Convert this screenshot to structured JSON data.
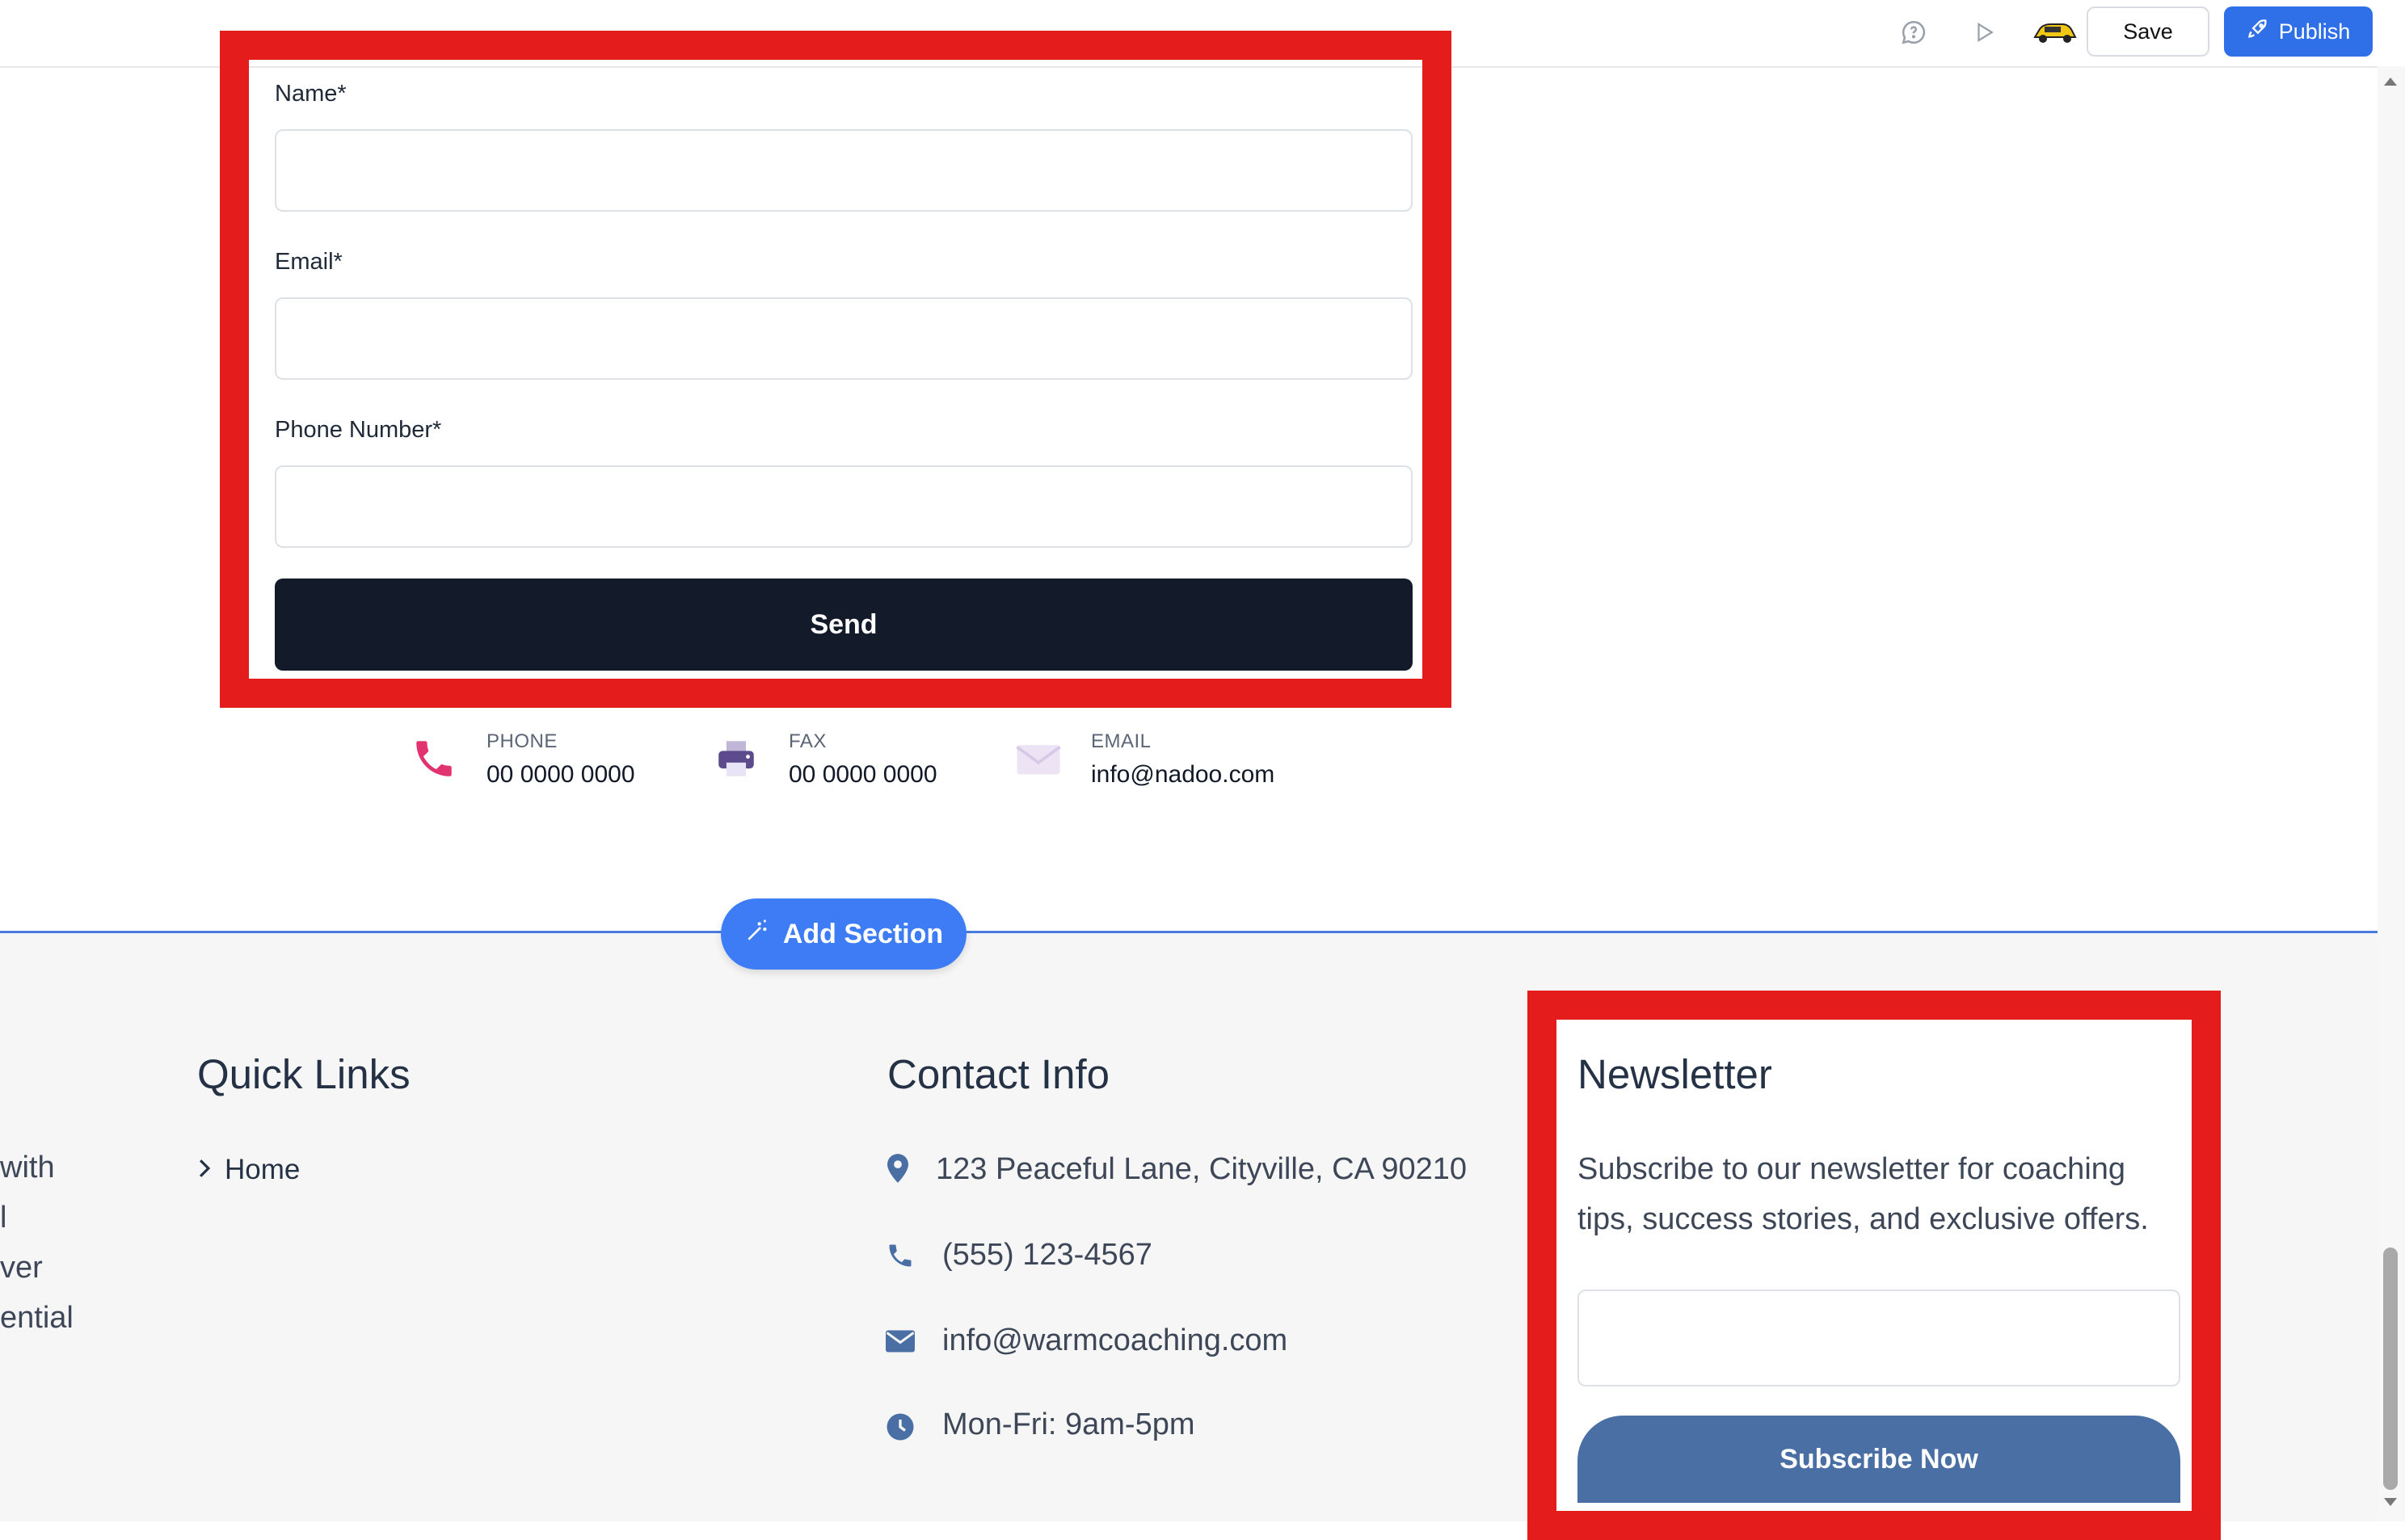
{
  "toolbar": {
    "save_label": "Save",
    "publish_label": "Publish",
    "icons": [
      "comment-icon",
      "play-icon",
      "car-avatar-icon",
      "rocket-icon"
    ]
  },
  "form": {
    "name_label": "Name*",
    "email_label": "Email*",
    "phone_label": "Phone Number*",
    "name_value": "",
    "email_value": "",
    "phone_value": "",
    "send_label": "Send"
  },
  "contact_strip": [
    {
      "label": "PHONE",
      "value": "00 0000 0000",
      "icon": "phone-icon"
    },
    {
      "label": "FAX",
      "value": "00 0000 0000",
      "icon": "fax-icon"
    },
    {
      "label": "EMAIL",
      "value": "info@nadoo.com",
      "icon": "envelope-icon"
    }
  ],
  "add_section_label": "Add Section",
  "footer": {
    "left_fragments": [
      "with",
      "l",
      "ver",
      "ential"
    ],
    "quick_links": {
      "heading": "Quick Links",
      "items": [
        "Home"
      ]
    },
    "contact_info": {
      "heading": "Contact Info",
      "address": "123 Peaceful Lane, Cityville, CA 90210",
      "phone": "(555) 123-4567",
      "email": "info@warmcoaching.com",
      "hours": "Mon-Fri: 9am-5pm"
    },
    "newsletter": {
      "heading": "Newsletter",
      "text_line1": "Subscribe to our newsletter for coaching",
      "text_line2": "tips, success stories, and exclusive offers.",
      "input_value": "",
      "button_label": "Subscribe Now"
    }
  },
  "colors": {
    "highlight": "#e41c1c",
    "publish": "#2f6fe8",
    "send": "#131a29",
    "add_section": "#3d7cf5",
    "subscribe": "#4a6fa5",
    "footer_icon": "#4a6fa5"
  }
}
